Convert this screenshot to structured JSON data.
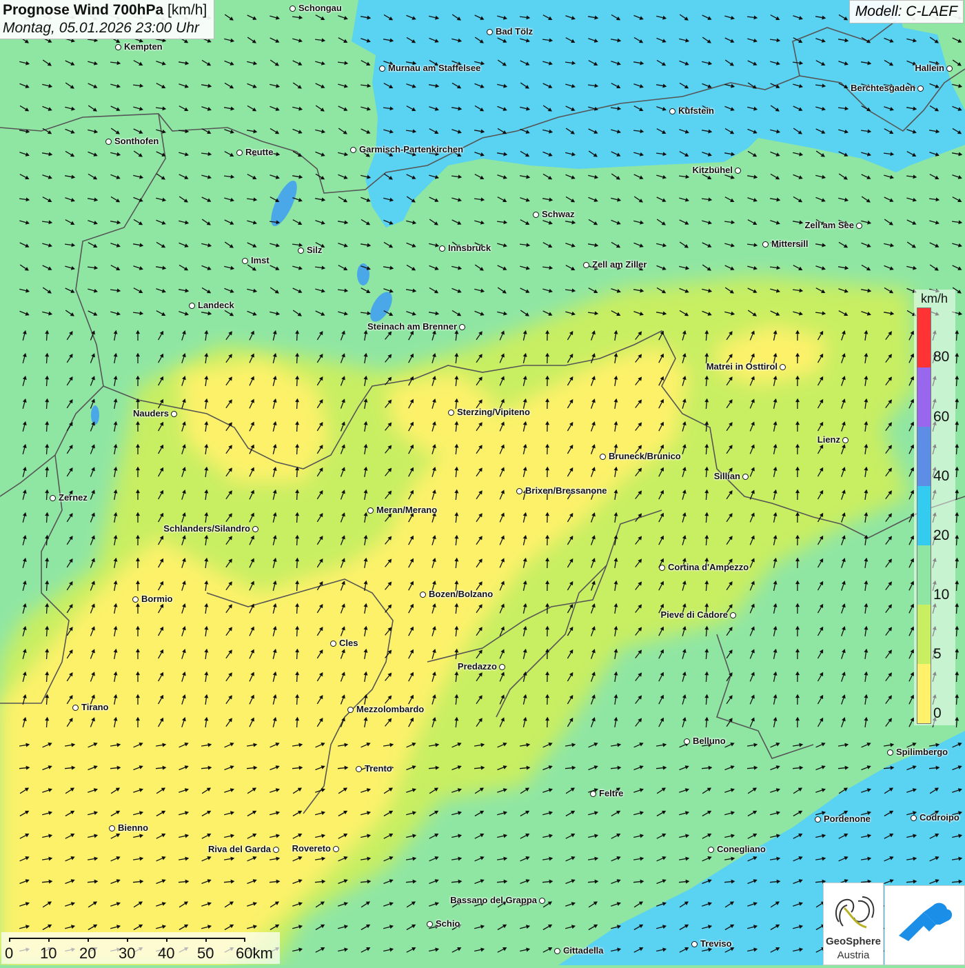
{
  "title": {
    "main": "Prognose Wind 700hPa",
    "unit": "[km/h]",
    "date": "Montag, 05.01.2026 23:00 Uhr"
  },
  "model": "Modell: C-LAEF",
  "legend": {
    "unit": "km/h",
    "labels": [
      "80",
      "60",
      "40",
      "20",
      "10",
      "5",
      "0"
    ],
    "colors": {
      "c70": "#ff3333",
      "c50": "#9966ee",
      "c30": "#5c8ee6",
      "c15": "#33ccf0",
      "c8": "#8fe6a3",
      "c3": "#c8ee62",
      "c0": "#fff26a"
    }
  },
  "cities": [
    {
      "id": "schongau",
      "name": "Schongau"
    },
    {
      "id": "bad-toelz",
      "name": "Bad Tölz"
    },
    {
      "id": "kempten",
      "name": "Kempten"
    },
    {
      "id": "murnau",
      "name": "Murnau am Staffelsee"
    },
    {
      "id": "hallein",
      "name": "Hallein"
    },
    {
      "id": "berchtesgaden",
      "name": "Berchtesgaden"
    },
    {
      "id": "kufstein",
      "name": "Kufstein"
    },
    {
      "id": "sonthofen",
      "name": "Sonthofen"
    },
    {
      "id": "reutte",
      "name": "Reutte"
    },
    {
      "id": "garmisch",
      "name": "Garmisch-Partenkirchen"
    },
    {
      "id": "kitzbuehel",
      "name": "Kitzbühel"
    },
    {
      "id": "schwaz",
      "name": "Schwaz"
    },
    {
      "id": "zell-am-see",
      "name": "Zell am See"
    },
    {
      "id": "mittersill",
      "name": "Mittersill"
    },
    {
      "id": "innsbruck",
      "name": "Innsbruck"
    },
    {
      "id": "silz",
      "name": "Silz"
    },
    {
      "id": "imst",
      "name": "Imst"
    },
    {
      "id": "zell-am-ziller",
      "name": "Zell am Ziller"
    },
    {
      "id": "landeck",
      "name": "Landeck"
    },
    {
      "id": "steinach",
      "name": "Steinach am Brenner"
    },
    {
      "id": "matrei",
      "name": "Matrei in Osttirol"
    },
    {
      "id": "nauders",
      "name": "Nauders"
    },
    {
      "id": "sterzing",
      "name": "Sterzing/Vipiteno"
    },
    {
      "id": "lienz",
      "name": "Lienz"
    },
    {
      "id": "bruneck",
      "name": "Bruneck/Brunico"
    },
    {
      "id": "sillian",
      "name": "Sillian"
    },
    {
      "id": "brixen",
      "name": "Brixen/Bressanone"
    },
    {
      "id": "zernez",
      "name": "Zernez"
    },
    {
      "id": "meran",
      "name": "Meran/Merano"
    },
    {
      "id": "schlanders",
      "name": "Schlanders/Silandro"
    },
    {
      "id": "cortina",
      "name": "Cortina d'Ampezzo"
    },
    {
      "id": "bozen",
      "name": "Bozen/Bolzano"
    },
    {
      "id": "bormio",
      "name": "Bormio"
    },
    {
      "id": "pieve",
      "name": "Pieve di Cadore"
    },
    {
      "id": "cles",
      "name": "Cles"
    },
    {
      "id": "predazzo",
      "name": "Predazzo"
    },
    {
      "id": "tirano",
      "name": "Tirano"
    },
    {
      "id": "mezzolombardo",
      "name": "Mezzolombardo"
    },
    {
      "id": "belluno",
      "name": "Belluno"
    },
    {
      "id": "spilimbergo",
      "name": "Spilimbergo"
    },
    {
      "id": "trento",
      "name": "Trento"
    },
    {
      "id": "feltre",
      "name": "Feltre"
    },
    {
      "id": "pordenone",
      "name": "Pordenone"
    },
    {
      "id": "codroipo",
      "name": "Codroipo"
    },
    {
      "id": "bienno",
      "name": "Bienno"
    },
    {
      "id": "riva",
      "name": "Riva del Garda"
    },
    {
      "id": "rovereto",
      "name": "Rovereto"
    },
    {
      "id": "conegliano",
      "name": "Conegliano"
    },
    {
      "id": "bassano",
      "name": "Bassano del Grappa"
    },
    {
      "id": "schio",
      "name": "Schio"
    },
    {
      "id": "treviso",
      "name": "Treviso"
    },
    {
      "id": "cittadella",
      "name": "Cittadella"
    }
  ],
  "scale": {
    "labels": [
      "0",
      "10",
      "20",
      "30",
      "40",
      "50",
      "60km"
    ]
  },
  "logo": {
    "name": "GeoSphere",
    "sub": "Austria"
  }
}
